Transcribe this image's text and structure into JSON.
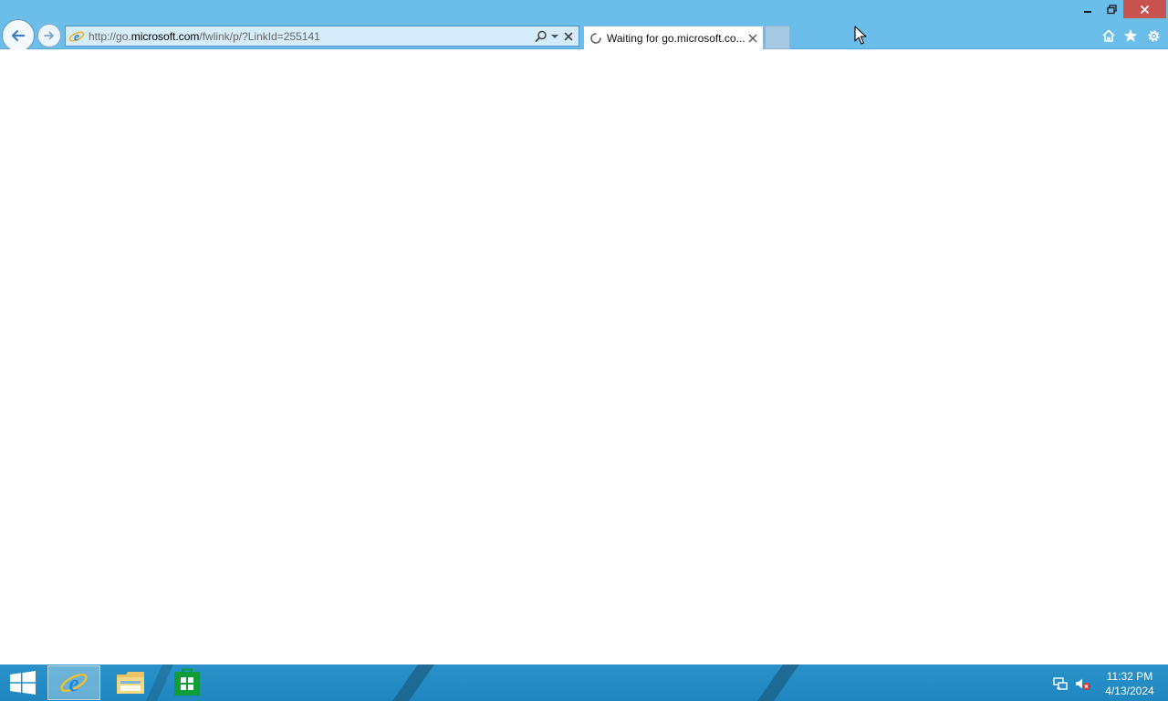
{
  "browser": {
    "address_bar": {
      "url_prefix": "http://go.",
      "url_domain": "microsoft.com",
      "url_path": "/fwlink/p/?LinkId=255141"
    },
    "tab": {
      "title": "Waiting for go.microsoft.co...",
      "state": "loading"
    },
    "icons": {
      "back": "back-arrow-icon",
      "forward": "forward-arrow-icon",
      "site": "ie-logo-icon",
      "search": "search-icon",
      "dropdown": "chevron-down-icon",
      "stop": "stop-icon",
      "home": "home-icon",
      "favorites": "star-icon",
      "tools": "gear-icon"
    }
  },
  "taskbar": {
    "clock": {
      "time": "11:32 PM",
      "date": "4/13/2024"
    },
    "pinned": [
      "internet-explorer",
      "file-explorer",
      "windows-store"
    ],
    "tray": [
      "network-icon",
      "volume-muted-icon"
    ]
  },
  "colors": {
    "chrome": "#6bbdea",
    "taskbar": "#2a92c9",
    "close_button": "#c7524e"
  }
}
